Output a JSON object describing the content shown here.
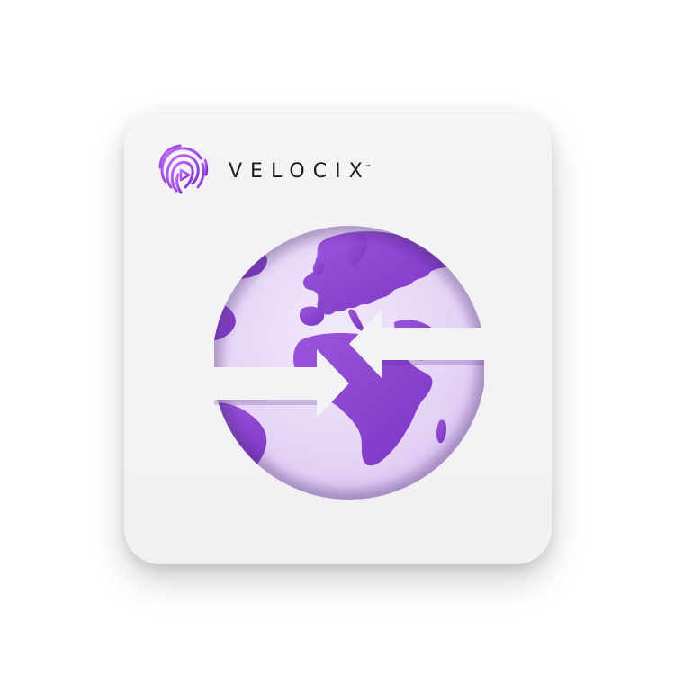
{
  "brand": {
    "name": "VELOCIX",
    "trademark": "™",
    "logo_icon": "fingerprint-play-icon",
    "accent_color": "#8a3fd1"
  },
  "hero": {
    "icon": "globe-exchange-arrows-icon",
    "land_color": "#8b44cf",
    "ocean_color": "#e6d6f5",
    "arrow_color": "#f3f2f4"
  }
}
